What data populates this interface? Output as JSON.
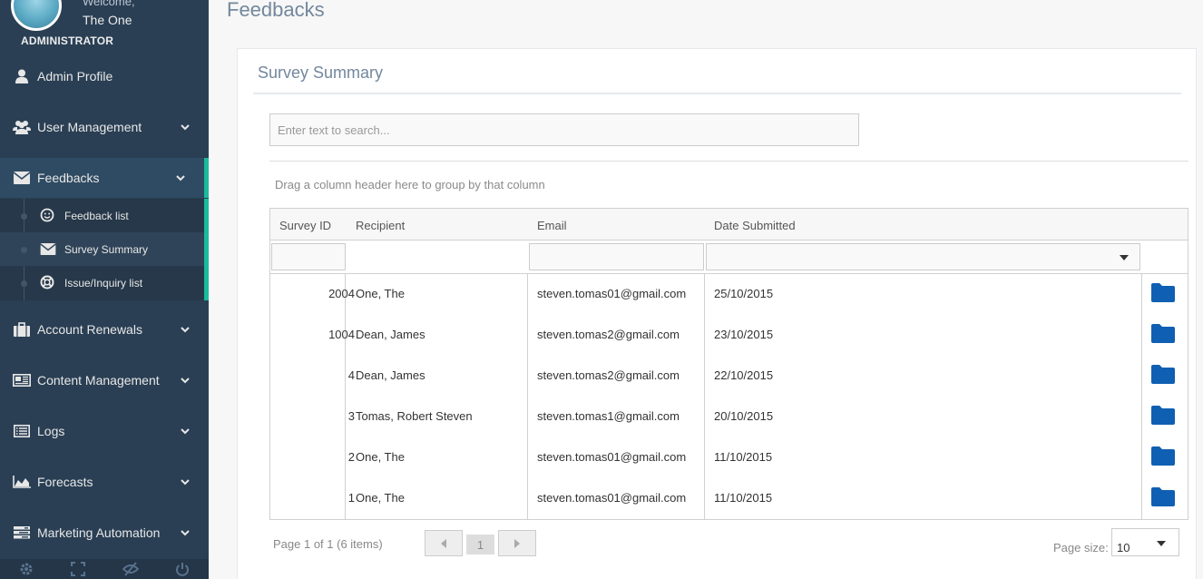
{
  "sidebar": {
    "profile": {
      "welcome": "Welcome,",
      "name": "The One",
      "role": "ADMINISTRATOR"
    },
    "items": [
      {
        "label": "Admin Profile",
        "icon": "user-icon"
      },
      {
        "label": "User Management",
        "icon": "users-icon"
      },
      {
        "label": "Feedbacks",
        "icon": "envelope-icon"
      },
      {
        "label": "Account Renewals",
        "icon": "briefcase-icon"
      },
      {
        "label": "Content Management",
        "icon": "newspaper-icon"
      },
      {
        "label": "Logs",
        "icon": "list-icon"
      },
      {
        "label": "Forecasts",
        "icon": "area-chart-icon"
      },
      {
        "label": "Marketing Automation",
        "icon": "tasks-icon"
      }
    ],
    "submenu": [
      {
        "label": "Feedback list",
        "icon": "smile-icon"
      },
      {
        "label": "Survey Summary",
        "icon": "envelope-icon"
      },
      {
        "label": "Issue/Inquiry list",
        "icon": "life-ring-icon"
      }
    ],
    "footer": [
      "settings-icon",
      "fullscreen-icon",
      "eye-slash-icon",
      "power-icon"
    ]
  },
  "page": {
    "title": "Feedbacks"
  },
  "panel": {
    "title": "Survey Summary",
    "search_placeholder": "Enter text to search...",
    "group_hint": "Drag a column header here to group by that column"
  },
  "grid": {
    "columns": [
      "Survey ID",
      "Recipient",
      "Email",
      "Date Submitted"
    ],
    "rows": [
      {
        "id": "2004",
        "recipient": "One, The",
        "email": "steven.tomas01@gmail.com",
        "date": "25/10/2015"
      },
      {
        "id": "1004",
        "recipient": "Dean, James",
        "email": "steven.tomas2@gmail.com",
        "date": "23/10/2015"
      },
      {
        "id": "4",
        "recipient": "Dean, James",
        "email": "steven.tomas2@gmail.com",
        "date": "22/10/2015"
      },
      {
        "id": "3",
        "recipient": "Tomas, Robert Steven",
        "email": "steven.tomas1@gmail.com",
        "date": "20/10/2015"
      },
      {
        "id": "2",
        "recipient": "One, The",
        "email": "steven.tomas01@gmail.com",
        "date": "11/10/2015"
      },
      {
        "id": "1",
        "recipient": "One, The",
        "email": "steven.tomas01@gmail.com",
        "date": "11/10/2015"
      }
    ]
  },
  "pager": {
    "info": "Page 1 of 1 (6 items)",
    "current": "1",
    "size_label": "Page size:",
    "size": "10"
  },
  "colors": {
    "sidebar": "#2a3f54",
    "accent": "#1abb9c",
    "folder": "#0f5fb3"
  }
}
